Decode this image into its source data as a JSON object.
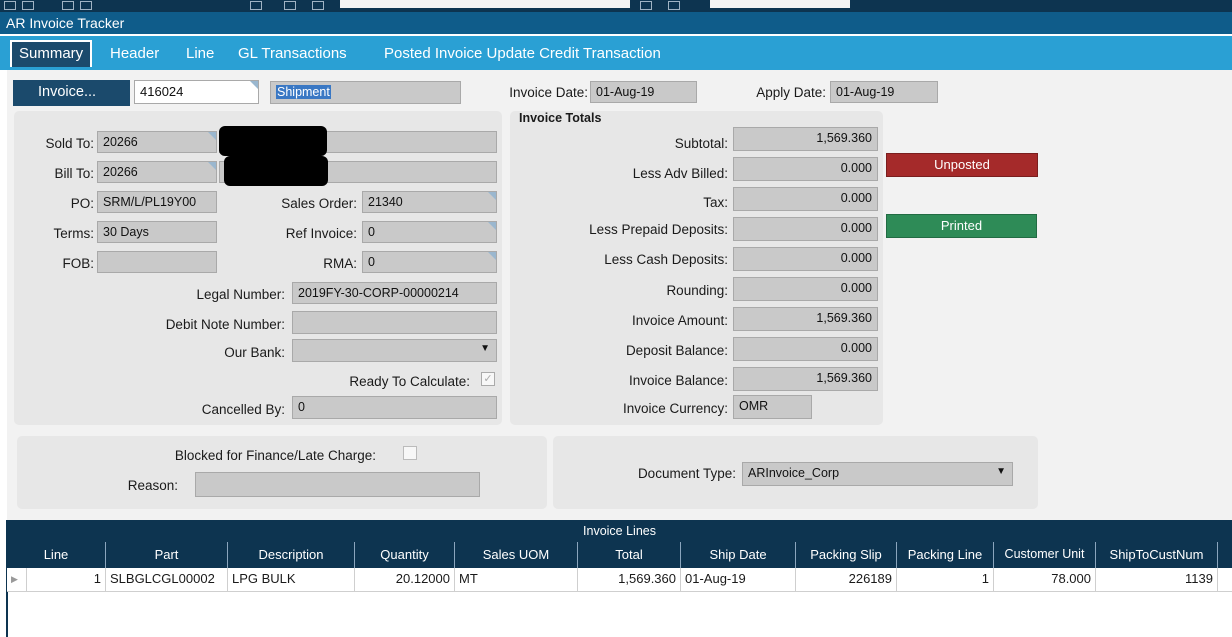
{
  "window": {
    "title": "AR Invoice Tracker"
  },
  "tabs": [
    "Summary",
    "Header",
    "Line",
    "GL Transactions",
    "Posted Invoice Update Credit Transaction"
  ],
  "invoice": {
    "button_label": "Invoice...",
    "number": "416024",
    "shipment_label": "Shipment",
    "invoice_date_label": "Invoice Date:",
    "invoice_date": "01-Aug-19",
    "apply_date_label": "Apply Date:",
    "apply_date": "01-Aug-19"
  },
  "details": {
    "sold_to_label": "Sold To:",
    "sold_to": "20266",
    "bill_to_label": "Bill To:",
    "bill_to": "20266",
    "po_label": "PO:",
    "po": "SRM/L/PL19Y00",
    "sales_order_label": "Sales Order:",
    "sales_order": "21340",
    "terms_label": "Terms:",
    "terms": "30 Days",
    "ref_invoice_label": "Ref Invoice:",
    "ref_invoice": "0",
    "fob_label": "FOB:",
    "fob": "",
    "rma_label": "RMA:",
    "rma": "0",
    "legal_number_label": "Legal Number:",
    "legal_number": "2019FY-30-CORP-00000214",
    "debit_note_label": "Debit Note Number:",
    "debit_note": "",
    "our_bank_label": "Our Bank:",
    "our_bank": "",
    "ready_to_calc_label": "Ready To Calculate:",
    "cancelled_by_label": "Cancelled By:",
    "cancelled_by": "0"
  },
  "totals": {
    "title": "Invoice Totals",
    "rows": [
      {
        "label": "Subtotal:",
        "value": "1,569.360"
      },
      {
        "label": "Less Adv Billed:",
        "value": "0.000"
      },
      {
        "label": "Tax:",
        "value": "0.000"
      },
      {
        "label": "Less Prepaid Deposits:",
        "value": "0.000"
      },
      {
        "label": "Less Cash Deposits:",
        "value": "0.000"
      },
      {
        "label": "Rounding:",
        "value": "0.000"
      },
      {
        "label": "Invoice Amount:",
        "value": "1,569.360"
      },
      {
        "label": "Deposit Balance:",
        "value": "0.000"
      },
      {
        "label": "Invoice Balance:",
        "value": "1,569.360"
      }
    ],
    "currency_label": "Invoice Currency:",
    "currency": "OMR"
  },
  "status": {
    "posted": "Unposted",
    "printed": "Printed",
    "posted_color": "#a52a2a",
    "printed_color": "#2e8b57"
  },
  "blocked": {
    "label": "Blocked for Finance/Late Charge:",
    "reason_label": "Reason:",
    "reason": ""
  },
  "document": {
    "label": "Document Type:",
    "value": "ARInvoice_Corp"
  },
  "lines": {
    "title": "Invoice Lines",
    "columns": [
      "Line",
      "Part",
      "Description",
      "Quantity",
      "Sales UOM",
      "Total",
      "Ship Date",
      "Packing Slip",
      "Packing Line",
      "Customer Unit",
      "ShipToCustNum"
    ],
    "rows": [
      [
        "1",
        "SLBGLCGL00002",
        "LPG BULK",
        "20.12000",
        "MT",
        "1,569.360",
        "01-Aug-19",
        "226189",
        "1",
        "78.000",
        "1139"
      ]
    ]
  }
}
